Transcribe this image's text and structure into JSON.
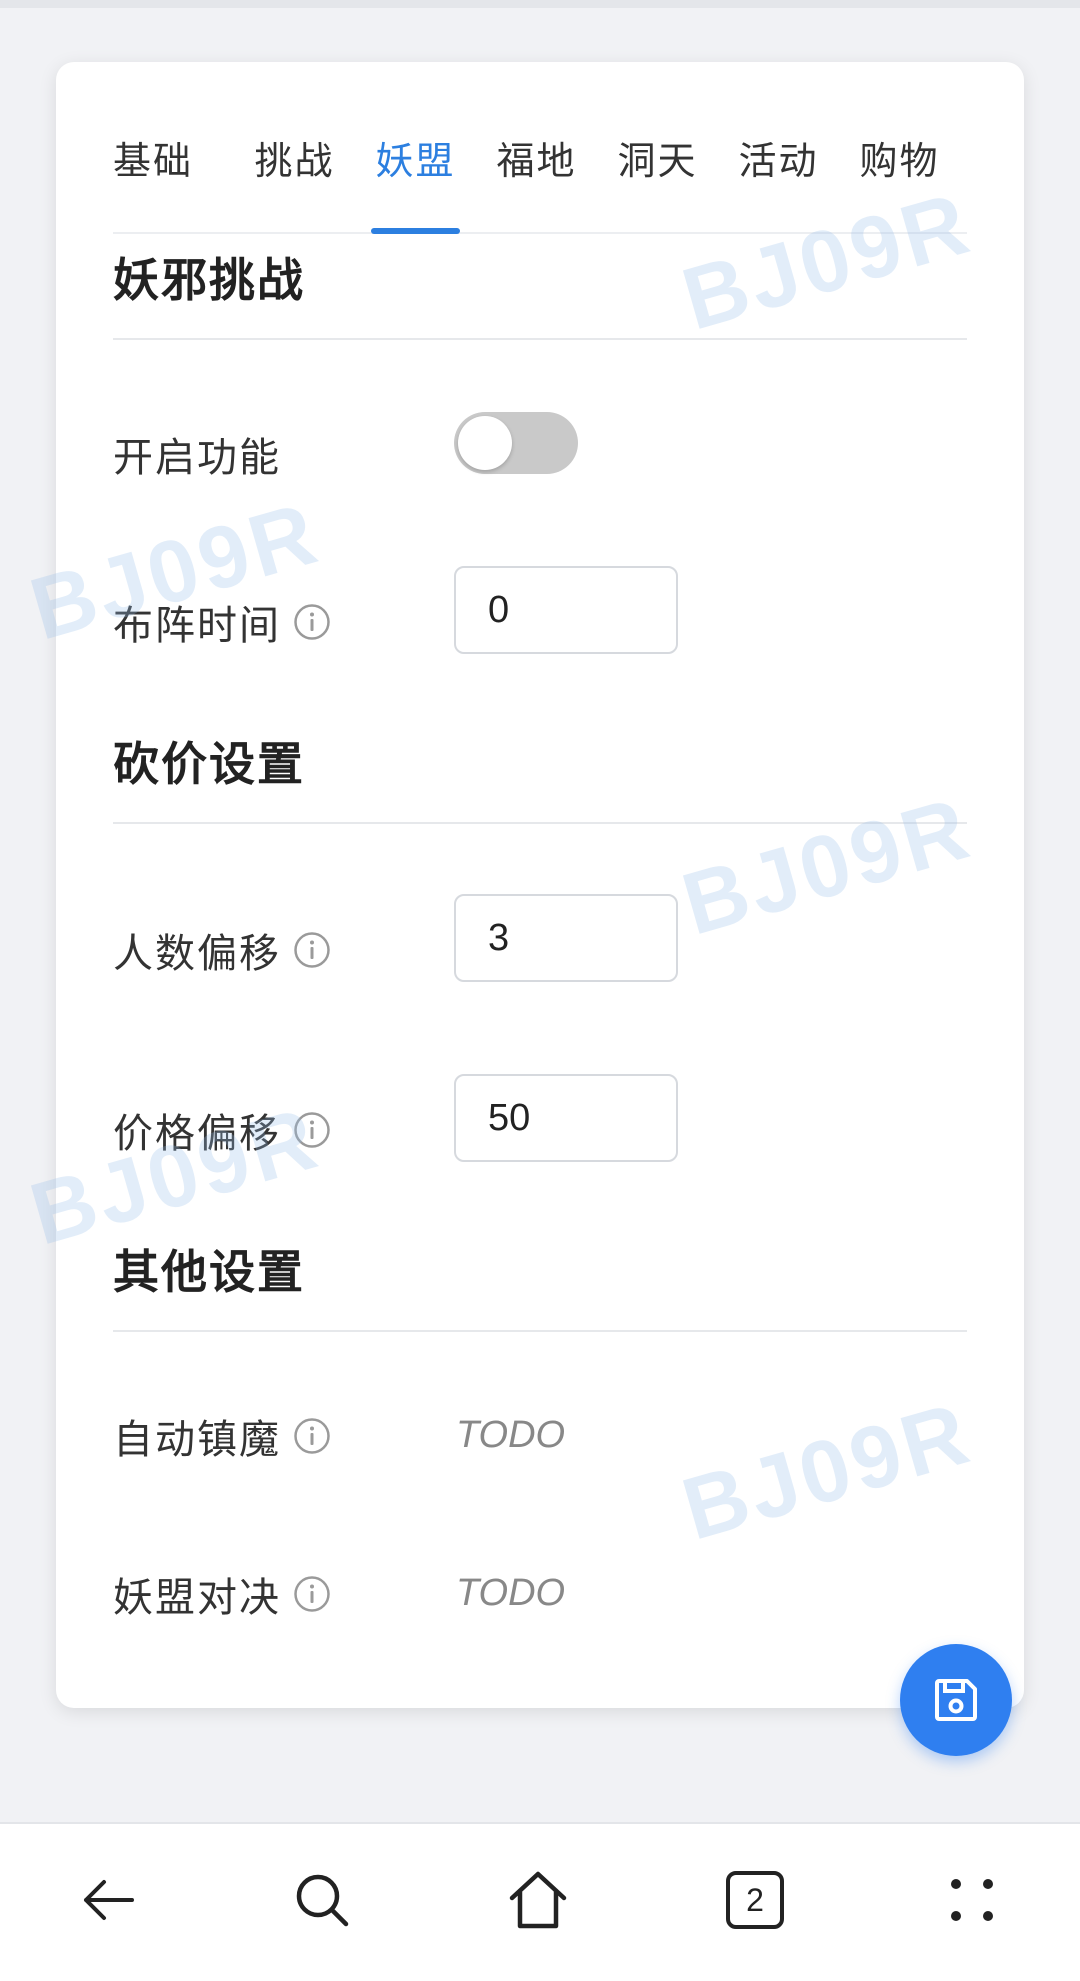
{
  "tabs": [
    {
      "label": "基础"
    },
    {
      "label": "挑战"
    },
    {
      "label": "妖盟"
    },
    {
      "label": "福地"
    },
    {
      "label": "洞天"
    },
    {
      "label": "活动"
    },
    {
      "label": "购物"
    }
  ],
  "active_tab_index": 2,
  "accent_color": "#2c7fe0",
  "watermark_text": "BJ09R",
  "sections": {
    "challenge": {
      "title": "妖邪挑战",
      "enable_label": "开启功能",
      "enable_value": false,
      "formation_label": "布阵时间",
      "formation_value": "0"
    },
    "bargain": {
      "title": "砍价设置",
      "people_offset_label": "人数偏移",
      "people_offset_value": "3",
      "price_offset_label": "价格偏移",
      "price_offset_value": "50"
    },
    "other": {
      "title": "其他设置",
      "auto_suppress_label": "自动镇魔",
      "auto_suppress_value": "TODO",
      "alliance_duel_label": "妖盟对决",
      "alliance_duel_value": "TODO"
    }
  },
  "fab": {
    "icon": "save-icon",
    "color": "#2f7ff0"
  },
  "navbar": {
    "back_icon": "back-arrow-icon",
    "search_icon": "search-icon",
    "home_icon": "home-icon",
    "tabs_count": "2",
    "menu_icon": "menu-dots-icon"
  }
}
